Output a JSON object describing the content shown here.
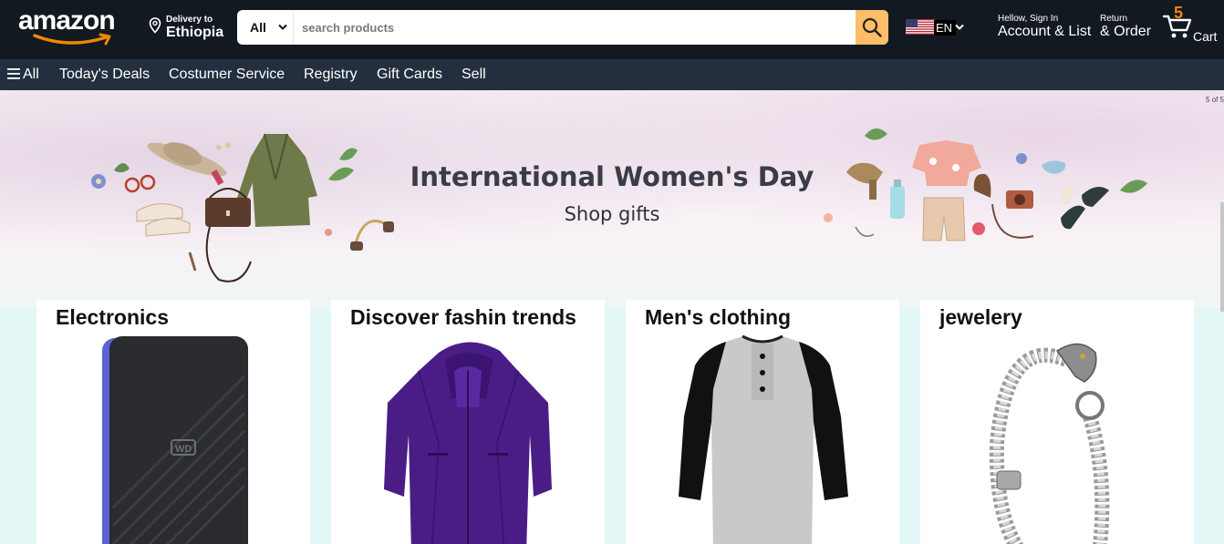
{
  "header": {
    "logo_text": "amazon",
    "delivery_label": "Delivery to",
    "delivery_location": "Ethiopia",
    "search_category": "All",
    "search_placeholder": "search products",
    "language": "EN",
    "account_greeting": "Hellow, Sign In",
    "account_label": "Account & List",
    "returns_label": "Return",
    "orders_label": "& Order",
    "cart_count": "5",
    "cart_label": "Cart"
  },
  "nav": {
    "all_label": "All",
    "items": [
      "Today's Deals",
      "Costumer Service",
      "Registry",
      "Gift Cards",
      "Sell"
    ]
  },
  "hero": {
    "title": "International Women's Day",
    "subtitle": "Shop gifts",
    "slide_indicator": "5 of 5"
  },
  "cards": [
    {
      "title": "Electronics",
      "image": "external-hard-drive"
    },
    {
      "title": "Discover fashin trends",
      "image": "purple-jacket"
    },
    {
      "title": "Men's clothing",
      "image": "raglan-henley-shirt"
    },
    {
      "title": "jewelery",
      "image": "dragon-bracelet"
    }
  ],
  "colors": {
    "header_bg": "#131921",
    "nav_bg": "#232f3e",
    "search_button": "#febd69",
    "cart_count": "#f08804",
    "page_bg": "#e3f7f6"
  }
}
